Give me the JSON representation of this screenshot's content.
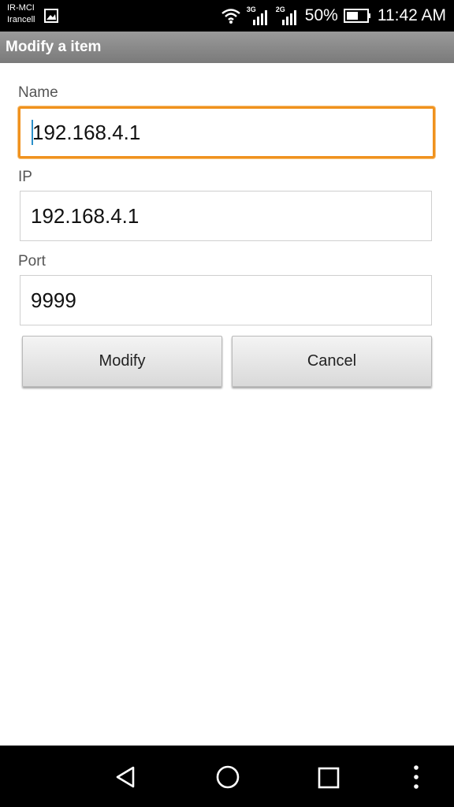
{
  "status_bar": {
    "carrier_1": "IR-MCI",
    "carrier_2": "Irancell",
    "sim1_network": "3G",
    "sim2_network": "2G",
    "battery_percent": "50%",
    "time": "11:42 AM",
    "icons": [
      "gallery-icon",
      "wifi-icon",
      "signal-icon",
      "battery-icon"
    ]
  },
  "header": {
    "title": "Modify a item"
  },
  "form": {
    "name_label": "Name",
    "name_value": "192.168.4.1",
    "ip_label": "IP",
    "ip_value": "192.168.4.1",
    "port_label": "Port",
    "port_value": "9999",
    "modify_label": "Modify",
    "cancel_label": "Cancel"
  },
  "nav_bar": {
    "icons": [
      "back-icon",
      "home-icon",
      "recents-icon",
      "overflow-menu-icon"
    ]
  },
  "colors": {
    "focus_border": "#f0921e",
    "cursor": "#2a8fc9",
    "title_bar": "#8a8a8a"
  }
}
